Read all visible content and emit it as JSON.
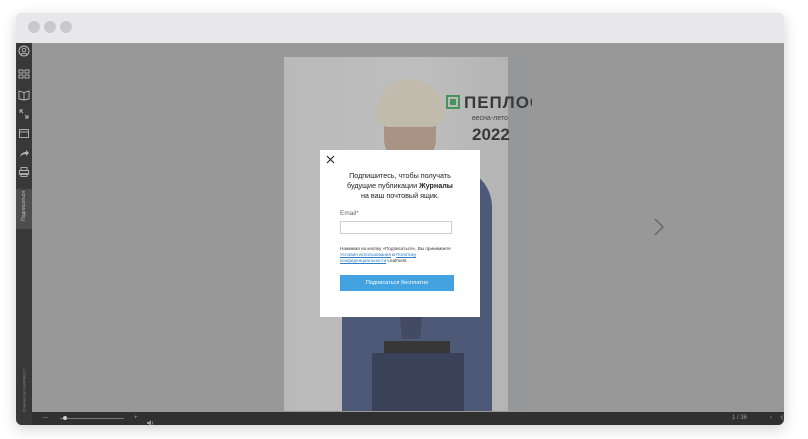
{
  "sidebar": {
    "icons": [
      "user-icon",
      "grid-icon",
      "book-icon",
      "fullscreen-icon",
      "calendar-icon",
      "share-icon",
      "print-icon"
    ],
    "subscribe_tab_label": "Подписаться",
    "powered_by": "Powered by LEAFMENT"
  },
  "magazine": {
    "logo_text": "ПЕПЛОС",
    "season": "весна-лето",
    "year": "2022"
  },
  "modal": {
    "message_line1": "Подпишитесь, чтобы получать",
    "message_line2_prefix": "будущие публикации ",
    "message_line2_bold": "Журналы",
    "message_line3": "на ваш почтовый ящик.",
    "email_label": "Email",
    "email_required_mark": "*",
    "email_value": "",
    "terms_text_1": "Нажимая на кнопку «Подписаться», Вы принимаете ",
    "terms_link_1": "Условия использования",
    "terms_text_2": " и ",
    "terms_link_2": "Политику конфиденциальности",
    "terms_text_3": " Leafment",
    "submit_label": "Подписаться бесплатно"
  },
  "bottombar": {
    "zoom_out": "—",
    "zoom_in": "+",
    "page_indicator": "1 / 36",
    "next": "›",
    "last": "›|",
    "zoom_level": 0.05
  },
  "colors": {
    "accent": "#43a3e0",
    "sidebar": "#1c1c1c",
    "logo_green": "#2e9d4a"
  }
}
